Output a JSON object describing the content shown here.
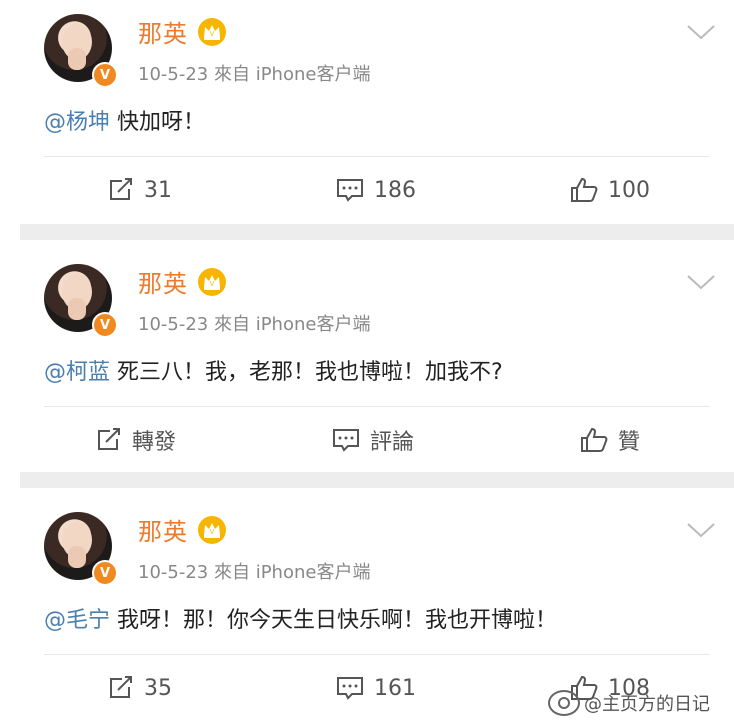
{
  "posts": [
    {
      "user": {
        "name": "那英",
        "vip": "V"
      },
      "meta": "10-5-23  來自 iPhone客户端",
      "mention": "@杨坤",
      "text": " 快加呀！",
      "actions": {
        "repost": "31",
        "comment": "186",
        "like": "100"
      }
    },
    {
      "user": {
        "name": "那英",
        "vip": "V"
      },
      "meta": "10-5-23  來自 iPhone客户端",
      "mention": "@柯蓝",
      "text": " 死三八！我，老那！我也博啦！加我不?",
      "actions": {
        "repost": "轉發",
        "comment": "評論",
        "like": "贊"
      }
    },
    {
      "user": {
        "name": "那英",
        "vip": "V"
      },
      "meta": "10-5-23  來自 iPhone客户端",
      "mention": "@毛宁",
      "text": " 我呀！那！你今天生日快乐啊！我也开博啦！",
      "actions": {
        "repost": "35",
        "comment": "161",
        "like": "108"
      }
    }
  ],
  "watermark": "@主页方的日记",
  "icons": {
    "repost": "repost-icon",
    "comment": "comment-icon",
    "like": "thumbs-up-icon",
    "crown": "crown-icon",
    "more": "chevron-down-icon"
  },
  "colors": {
    "name": "#f07a2a",
    "mention": "#4a7fb0",
    "crown": "#f7b500",
    "verified": "#f08a20"
  }
}
